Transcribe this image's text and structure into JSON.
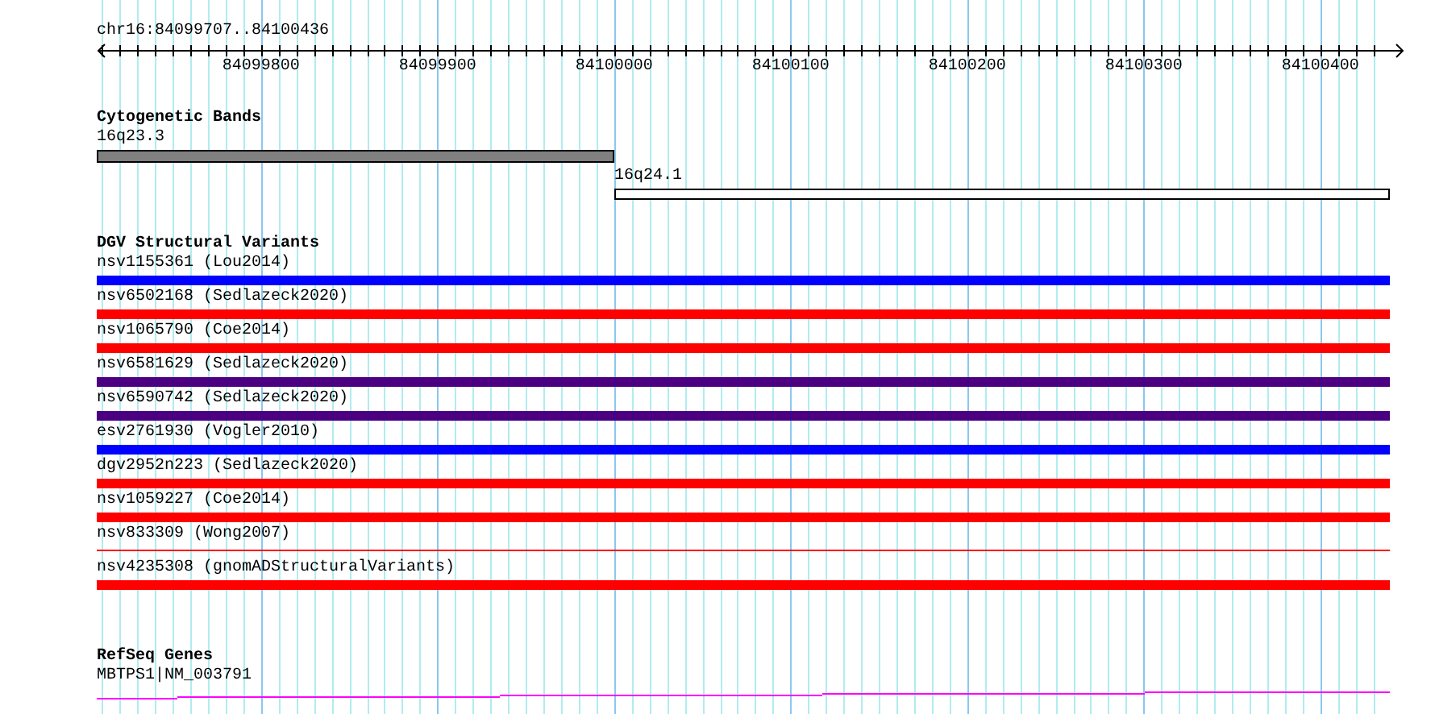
{
  "ruler": {
    "location": "chr16:84099707..84100436",
    "ticks": [
      "84099800",
      "84099900",
      "84100000",
      "84100100",
      "84100200",
      "84100300",
      "84100400"
    ]
  },
  "tracks": [
    {
      "kind": "bands",
      "title": "Cytogenetic Bands",
      "features": [
        {
          "label": "16q23.3",
          "color": "#808080"
        },
        {
          "label": "16q24.1",
          "color": "#ffffff"
        }
      ]
    },
    {
      "kind": "variants",
      "title": "DGV Structural Variants",
      "features": [
        {
          "label": "nsv1155361 (Lou2014)",
          "kind": "bar",
          "color": "#0000ff"
        },
        {
          "label": "nsv6502168 (Sedlazeck2020)",
          "kind": "bar",
          "color": "#ff0000"
        },
        {
          "label": "nsv1065790 (Coe2014)",
          "kind": "bar",
          "color": "#ff0000"
        },
        {
          "label": "nsv6581629 (Sedlazeck2020)",
          "kind": "bar",
          "color": "#4b0082"
        },
        {
          "label": "nsv6590742 (Sedlazeck2020)",
          "kind": "bar",
          "color": "#4b0082"
        },
        {
          "label": "esv2761930 (Vogler2010)",
          "kind": "bar",
          "color": "#0000ff"
        },
        {
          "label": "dgv2952n223 (Sedlazeck2020)",
          "kind": "bar",
          "color": "#ff0000"
        },
        {
          "label": "nsv1059227 (Coe2014)",
          "kind": "bar",
          "color": "#ff0000"
        },
        {
          "label": "nsv833309 (Wong2007)",
          "kind": "line",
          "color": "#ff0000"
        },
        {
          "label": "nsv4235308 (gnomADStructuralVariants)",
          "kind": "bar",
          "color": "#ff0000"
        }
      ]
    },
    {
      "kind": "genes",
      "title": "RefSeq Genes",
      "features": [
        {
          "label": "MBTPS1|NM_003791"
        }
      ]
    }
  ]
}
